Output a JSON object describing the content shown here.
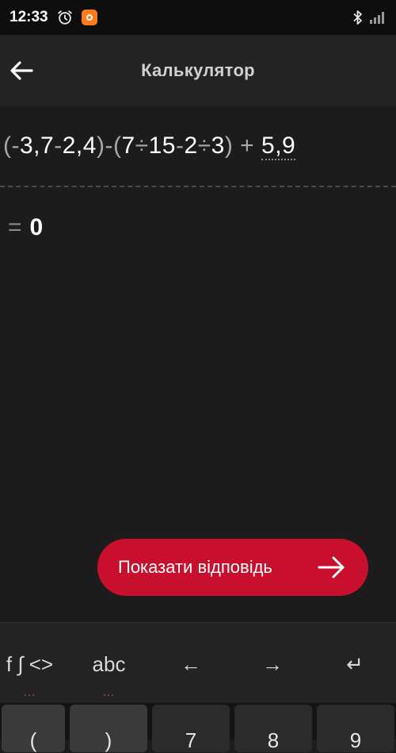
{
  "status": {
    "time": "12:33"
  },
  "appbar": {
    "title": "Калькулятор"
  },
  "expression": {
    "tokens": [
      {
        "t": "(",
        "op": true
      },
      {
        "t": "-",
        "op": true
      },
      {
        "t": "3,7",
        "op": false
      },
      {
        "t": "-",
        "op": true
      },
      {
        "t": "2,4",
        "op": false
      },
      {
        "t": ")",
        "op": true
      },
      {
        "t": "-",
        "op": true
      },
      {
        "t": "(",
        "op": true
      },
      {
        "t": "7",
        "op": false
      },
      {
        "t": "÷",
        "op": true
      },
      {
        "t": "15",
        "op": false
      },
      {
        "t": "-",
        "op": true
      },
      {
        "t": "2",
        "op": false
      },
      {
        "t": "÷",
        "op": true
      },
      {
        "t": "3",
        "op": false
      },
      {
        "t": ")",
        "op": true
      },
      {
        "t": " + ",
        "op": true
      },
      {
        "t": "5,9",
        "op": false,
        "last": true
      }
    ]
  },
  "result": {
    "eq": "=",
    "value": "0"
  },
  "show_answer": {
    "label": "Показати відповідь"
  },
  "keyboard": {
    "toolbar": {
      "functions_label": "f ∫ <>",
      "abc_label": "abc",
      "left_label": "←",
      "right_label": "→",
      "enter_label": "↵",
      "dots": "…"
    },
    "keys": [
      "(",
      ")",
      "7",
      "8",
      "9"
    ]
  },
  "colors": {
    "accent": "#c8102e",
    "background": "#1c1c1c",
    "appbar": "#232323"
  }
}
